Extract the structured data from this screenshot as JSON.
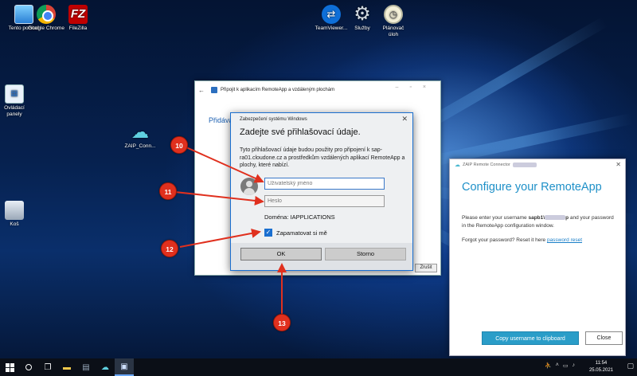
{
  "desktop": {
    "icons": [
      {
        "label": "Tento počítač",
        "icon": "computer-icon"
      },
      {
        "label": "Google Chrome",
        "icon": "chrome-icon"
      },
      {
        "label": "FileZilla",
        "icon": "filezilla-icon",
        "glyph": "FZ"
      },
      {
        "label": "TeamViewer...",
        "icon": "teamviewer-icon",
        "glyph": "⇄"
      },
      {
        "label": "Služby",
        "icon": "gears-icon",
        "glyph": "⚙"
      },
      {
        "label": "Plánovač úloh",
        "icon": "clock-icon",
        "glyph": "◷"
      },
      {
        "label": "Ovládací panely",
        "icon": "control-panel-icon",
        "glyph": "▦"
      },
      {
        "label": "ZAIP_Conn...",
        "icon": "cloud-icon",
        "glyph": "☁"
      },
      {
        "label": "Koš",
        "icon": "recycle-bin-icon"
      }
    ]
  },
  "remoteapp_window": {
    "title": "Připojit k aplikacím RemoteApp a vzdáleným plochám",
    "heading": "Přidává",
    "cancel_label": "Zrušit"
  },
  "credential_dialog": {
    "title": "Zabezpečení systému Windows",
    "heading": "Zadejte své přihlašovací údaje.",
    "description": "Tyto přihlašovací údaje budou použity pro připojení k sap-ra01.cloudone.cz a prostředkům vzdálených aplikací RemoteApp a plochy, které nabízí.",
    "username_placeholder": "Uživatelský jméno",
    "password_placeholder": "Heslo",
    "domain": "Doména: IAPPLICATIONS",
    "remember_label": "Zapamatovat si mě",
    "remember_checked": true,
    "ok_label": "OK",
    "cancel_label": "Storno"
  },
  "zaip_window": {
    "title": "ZAIP Remote Connector",
    "heading": "Configure your RemoteApp",
    "text_part1": "Please enter your username",
    "username_prefix": "sapb1\\",
    "username_suffix": "p",
    "text_part2": "and your password in the RemoteApp configuration window.",
    "forgot_text": "Forgot your password? Reset it here",
    "reset_link": "password reset",
    "copy_button": "Copy username to clipboard",
    "close_button": "Close",
    "accent_color": "#1e90c8"
  },
  "callouts": [
    "10",
    "11",
    "12",
    "13"
  ],
  "taskbar": {
    "time": "11:54",
    "date": "25.05.2021"
  }
}
